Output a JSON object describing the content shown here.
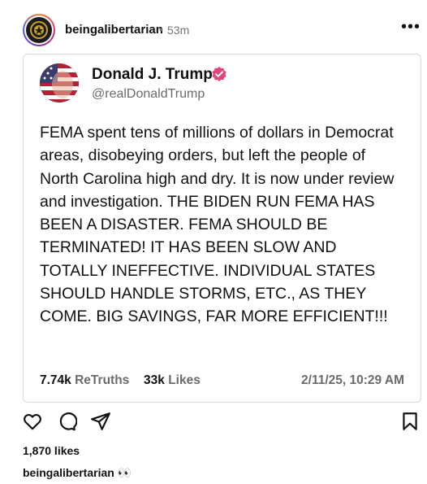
{
  "header": {
    "username": "beingalibertarian",
    "separator": "•",
    "time": "53m",
    "more": "•••"
  },
  "truth": {
    "name": "Donald J. Trump",
    "handle": "@realDonaldTrump",
    "body": "FEMA spent tens of millions of dollars in Democrat areas, disobeying orders, but left the people of North Carolina high and dry. It is now under review and investigation. THE BIDEN RUN FEMA HAS BEEN A DISASTER. FEMA SHOULD BE TERMINATED! IT HAS BEEN SLOW AND TOTALLY INEFFECTIVE. INDIVIDUAL STATES SHOULD HANDLE STORMS, ETC., AS THEY COME. BIG SAVINGS, FAR MORE EFFICIENT!!!",
    "retruths_count": "7.74k",
    "retruths_label": "ReTruths",
    "likes_count": "33k",
    "likes_label": "Likes",
    "date": "2/11/25, 10:29 AM",
    "verified_color": "#e0457b"
  },
  "post": {
    "likes": "1,870 likes",
    "caption_user": "beingalibertarian",
    "caption_text": "👀"
  },
  "icons": [
    "heart-icon",
    "comment-icon",
    "share-icon",
    "bookmark-icon"
  ]
}
